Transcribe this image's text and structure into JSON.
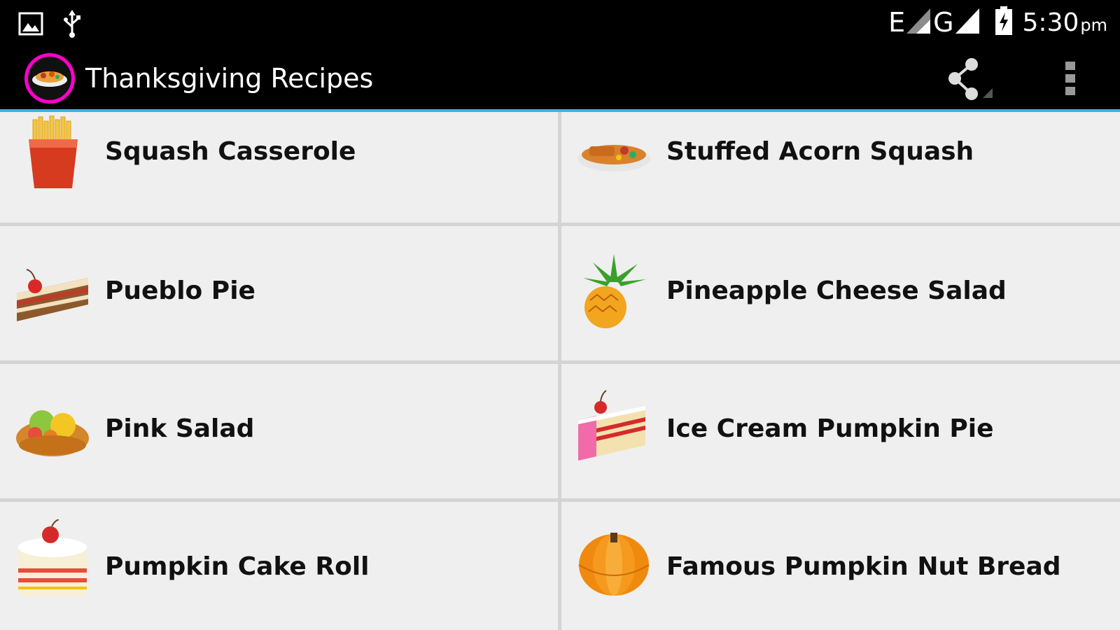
{
  "status_bar": {
    "network_1": "E",
    "network_2": "G",
    "time": "5:30",
    "ampm": "pm",
    "icons": [
      "image-icon",
      "usb-icon",
      "signal-icon",
      "signal-icon",
      "battery-charging-icon"
    ]
  },
  "action_bar": {
    "title": "Thanksgiving Recipes",
    "app_icon": "food-bowl-icon",
    "share_icon": "share-icon",
    "overflow_icon": "overflow-menu-icon",
    "accent_color": "#33b5e5",
    "icon_ring_color": "#ff00cc"
  },
  "recipes": [
    {
      "label": "Squash Casserole",
      "icon": "french-fries-icon"
    },
    {
      "label": "Stuffed Acorn Squash",
      "icon": "casserole-dish-icon"
    },
    {
      "label": "Pueblo Pie",
      "icon": "cake-slice-icon"
    },
    {
      "label": "Pineapple Cheese Salad",
      "icon": "pineapple-icon"
    },
    {
      "label": "Pink Salad",
      "icon": "fruit-bowl-icon"
    },
    {
      "label": "Ice Cream Pumpkin Pie",
      "icon": "pink-cake-slice-icon"
    },
    {
      "label": "Pumpkin Cake Roll",
      "icon": "layer-cake-icon"
    },
    {
      "label": "Famous Pumpkin Nut Bread",
      "icon": "pumpkin-icon"
    }
  ]
}
